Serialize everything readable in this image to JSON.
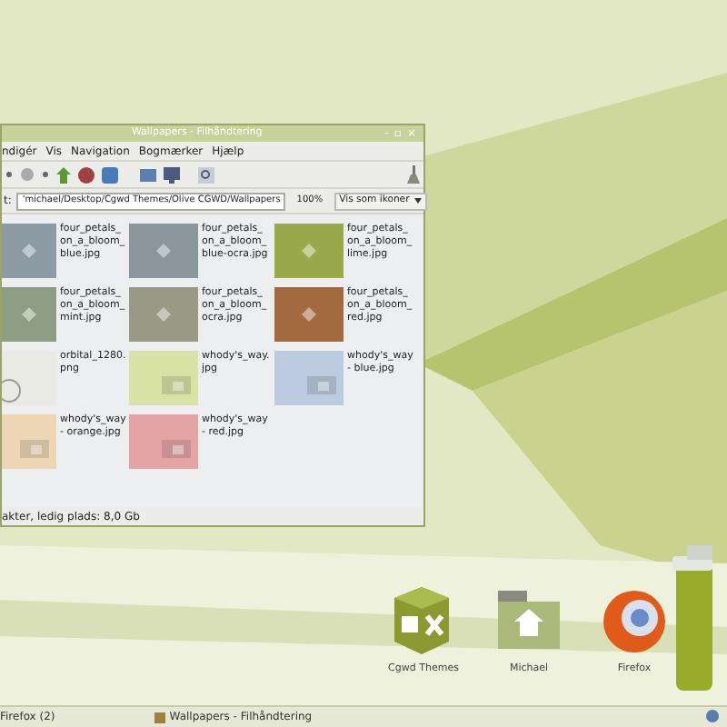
{
  "window": {
    "title": "Wallpapers - Filhåndtering",
    "controls": [
      "-",
      "▫",
      "×"
    ]
  },
  "menu": [
    "ndigér",
    "Vis",
    "Navigation",
    "Bogmærker",
    "Hjælp"
  ],
  "location": {
    "label": "t:",
    "path": "'michael/Desktop/Cgwd Themes/Olive CGWD/Wallpapers",
    "zoom": "100%",
    "view": "Vis som ikoner"
  },
  "files": [
    {
      "name": "four_petals_ on_a_bloom_ blue.jpg",
      "kind": "petal",
      "color": "#8c9aa4"
    },
    {
      "name": "four_petals_ on_a_bloom_ blue-ocra.jpg",
      "kind": "petal",
      "color": "#8a969c"
    },
    {
      "name": "four_petals_ on_a_bloom_ lime.jpg",
      "kind": "petal",
      "color": "#9aa84c"
    },
    {
      "name": "four_petals_ on_a_bloom_ mint.jpg",
      "kind": "petal",
      "color": "#8e9e84"
    },
    {
      "name": "four_petals_ on_a_bloom_ ocra.jpg",
      "kind": "petal",
      "color": "#9a9a84"
    },
    {
      "name": "four_petals_ on_a_bloom_ red.jpg",
      "kind": "petal",
      "color": "#a26a3e"
    },
    {
      "name": "orbital_1280. png",
      "kind": "orbital",
      "color": "#eaeae4"
    },
    {
      "name": "whody's_way. jpg",
      "kind": "way",
      "color": "#d8e2a4"
    },
    {
      "name": "whody's_way- blue.jpg",
      "kind": "way",
      "color": "#bccbe0"
    },
    {
      "name": "whody's_way- orange.jpg",
      "kind": "way",
      "color": "#ecd6b4"
    },
    {
      "name": "whody's_way- red.jpg",
      "kind": "way",
      "color": "#e4a4a4"
    }
  ],
  "status_bar": "akter, ledig plads: 8,0 Gb",
  "dock": [
    {
      "label": "Cgwd Themes",
      "kind": "cube"
    },
    {
      "label": "Michael",
      "kind": "home"
    },
    {
      "label": "Firefox",
      "kind": "browser"
    },
    {
      "kind": "trash"
    }
  ],
  "taskbar": [
    {
      "label": "Firefox (2)",
      "kind": "plain"
    },
    {
      "label": "Wallpapers - Filhåndtering",
      "kind": "window"
    }
  ]
}
